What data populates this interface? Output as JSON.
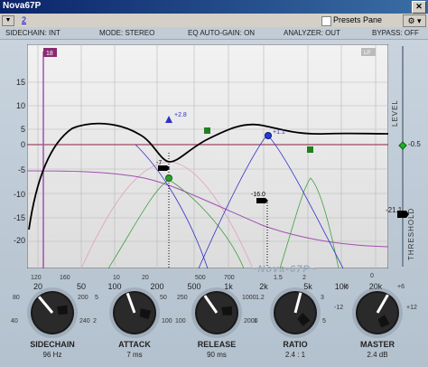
{
  "window": {
    "title": "Nova67P",
    "close_label": "✕"
  },
  "menubar": {
    "arrow": "▼",
    "page": "2",
    "presets_label": "Presets Pane",
    "settings_icon": "gear-icon",
    "settings_label": "⚙ ▾"
  },
  "header": {
    "sidechain": "SIDECHAIN: INT",
    "mode": "MODE: STEREO",
    "autogain": "EQ AUTO-GAIN: ON",
    "analyzer": "ANALYZER: OUT",
    "bypass": "BYPASS: OFF"
  },
  "graph": {
    "band_marker": "18",
    "lp_label": "LP",
    "markers": {
      "b1": "+2.8",
      "b2": "-7",
      "b3": "+1.1",
      "b4": "-16.0"
    },
    "y_labels": [
      "15",
      "10",
      "5",
      "0",
      "-5",
      "-10",
      "-15",
      "-20"
    ],
    "freq_labels": [
      "20",
      "50",
      "100",
      "200",
      "500",
      "1k",
      "2k",
      "5k",
      "10k",
      "20k"
    ],
    "level_label": "LEVEL",
    "threshold_label": "THRESHOLD",
    "level_value": "-0.5",
    "threshold_value": "-21.1",
    "colors": {
      "curve": "#000000",
      "blue": "#3030c8",
      "green": "#20a020",
      "purple": "#a050b0",
      "zero_line": "#8b2040"
    }
  },
  "logo": "~Nova-67P~",
  "knobs": [
    {
      "label": "SIDECHAIN",
      "value": "96 Hz",
      "ticks": [
        "120",
        "160",
        "80",
        "200",
        "40",
        "240"
      ]
    },
    {
      "label": "ATTACK",
      "value": "7 ms",
      "ticks": [
        "10",
        "20",
        "5",
        "50",
        "2",
        "100"
      ]
    },
    {
      "label": "RELEASE",
      "value": "90 ms",
      "ticks": [
        "500",
        "700",
        "250",
        "1000",
        "100",
        "2000"
      ]
    },
    {
      "label": "RATIO",
      "value": "2.4 : 1",
      "ticks": [
        "1.5",
        "2",
        "1.2",
        "3",
        "1",
        "5"
      ]
    },
    {
      "label": "MASTER",
      "value": "2.4 dB",
      "ticks": [
        "0",
        "-6",
        "+6",
        "-12",
        "+12"
      ]
    }
  ]
}
